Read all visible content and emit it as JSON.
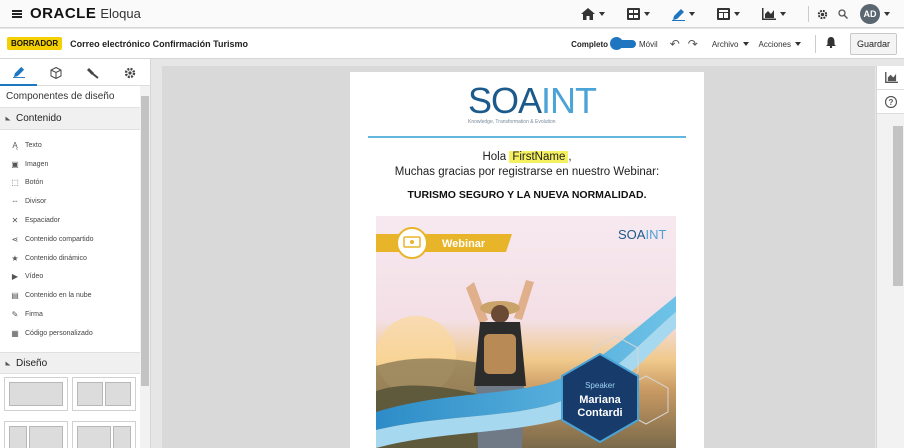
{
  "app": {
    "brand": "ORACLE",
    "product": "Eloqua",
    "avatar_initials": "AD"
  },
  "toolbar": {
    "status_badge": "BORRADOR",
    "doc_title": "Correo electrónico Confirmación Turismo",
    "view_full": "Completo",
    "view_mobile": "Móvil",
    "menu_file": "Archivo",
    "menu_actions": "Acciones",
    "save_label": "Guardar"
  },
  "left_panel": {
    "heading": "Componentes de diseño",
    "section_content": "Contenido",
    "components": [
      {
        "icon": "text-icon",
        "label": "Texto"
      },
      {
        "icon": "image-icon",
        "label": "Imagen"
      },
      {
        "icon": "button-icon",
        "label": "Botón"
      },
      {
        "icon": "divider-icon",
        "label": "Divisor"
      },
      {
        "icon": "spacer-icon",
        "label": "Espaciador"
      },
      {
        "icon": "share-icon",
        "label": "Contenido compartido"
      },
      {
        "icon": "star-icon",
        "label": "Contenido dinámico"
      },
      {
        "icon": "play-icon",
        "label": "Vídeo"
      },
      {
        "icon": "cloud-file-icon",
        "label": "Contenido en la nube"
      },
      {
        "icon": "pen-icon",
        "label": "Firma"
      },
      {
        "icon": "code-icon",
        "label": "Código personalizado"
      }
    ],
    "section_design": "Diseño"
  },
  "email": {
    "logo_part1": "SOA",
    "logo_part2": "INT",
    "tagline": "Knowledge, Transformation & Evolution",
    "greeting": "Hola",
    "field_merge": "FirstName",
    "greeting_suffix": ",",
    "line2": "Muchas gracias por registrarse en nuestro Webinar:",
    "headline": "TURISMO SEGURO Y LA NUEVA NORMALIDAD.",
    "banner": {
      "webinar_label": "Webinar",
      "logo_part1": "SOA",
      "logo_part2": "INT",
      "speaker_label": "Speaker",
      "speaker_first": "Mariana",
      "speaker_last": "Contardi"
    }
  },
  "colors": {
    "accent": "#1f76c0",
    "badge": "#f5d000",
    "brand_dark": "#1b5a8a",
    "brand_light": "#4ba3d6",
    "webinar_gold": "#e8b52a",
    "hex_navy": "#173b6b"
  }
}
